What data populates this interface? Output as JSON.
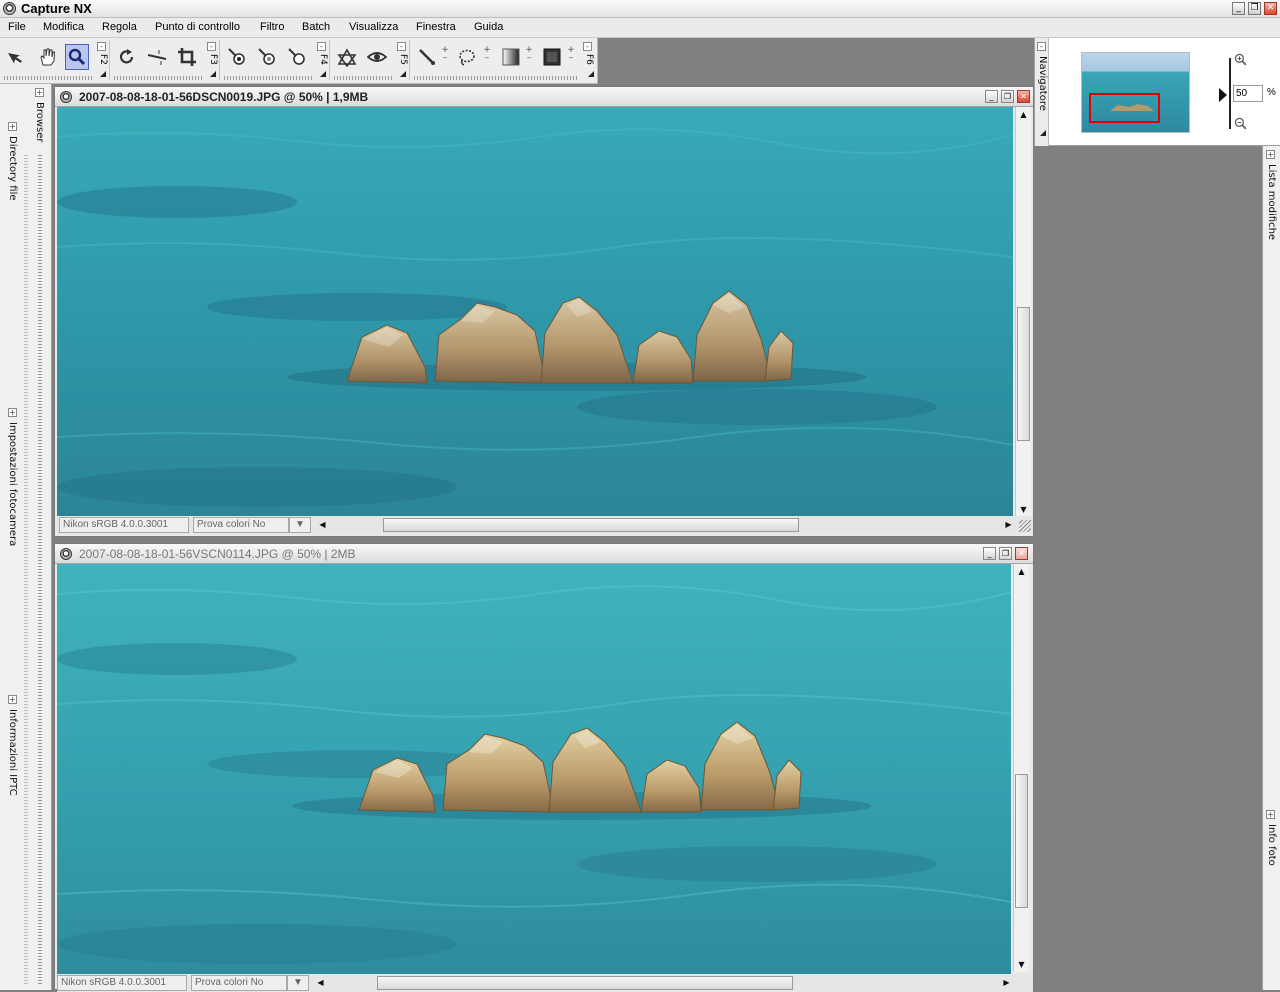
{
  "app": {
    "title": "Capture NX"
  },
  "window_controls": {
    "minimize": "_",
    "restore": "❐",
    "close": "✕"
  },
  "menu": [
    "File",
    "Modifica",
    "Regola",
    "Punto di controllo",
    "Filtro",
    "Batch",
    "Visualizza",
    "Finestra",
    "Guida"
  ],
  "toolbar": {
    "groups": [
      {
        "tools": [
          "arrow-icon",
          "hand-icon",
          "zoom-icon"
        ],
        "active": "zoom-icon",
        "fkey": "F2"
      },
      {
        "tools": [
          "rotate-icon",
          "straighten-icon",
          "crop-icon"
        ],
        "fkey": "F3"
      },
      {
        "tools": [
          "black-point-icon",
          "neutral-point-icon",
          "white-point-icon"
        ],
        "fkey": "F4"
      },
      {
        "tools": [
          "red-eye-icon",
          "eye-icon"
        ],
        "fkey": "F5"
      },
      {
        "tools": [
          "brush-icon",
          "lasso-icon",
          "gradient-icon",
          "fill-icon"
        ],
        "fkey": "F6"
      }
    ]
  },
  "left_dock": {
    "tabs": [
      "Browser",
      "Directory file",
      "Impostazioni fotocamera",
      "Informazioni IPTC"
    ]
  },
  "right_dock": {
    "tabs": [
      "Navigatore",
      "Lista modifiche",
      "Info foto"
    ]
  },
  "navigator": {
    "zoom_value": "50",
    "zoom_unit": "%"
  },
  "windows": [
    {
      "title": "2007-08-08-18-01-56DSCN0019.JPG  @  50%  |  1,9MB",
      "active": true,
      "profile": "Nikon sRGB 4.0.0.3001",
      "softproof": "Prova colori No"
    },
    {
      "title": "2007-08-08-18-01-56VSCN0114.JPG  @  50%  |  2MB",
      "active": false,
      "profile": "Nikon sRGB 4.0.0.3001",
      "softproof": "Prova colori No"
    }
  ],
  "colors": {
    "sea": "#2f95a6",
    "sea_light": "#3fb5c0",
    "rock": "#b79a69",
    "navigator_frame": "#e00000"
  }
}
